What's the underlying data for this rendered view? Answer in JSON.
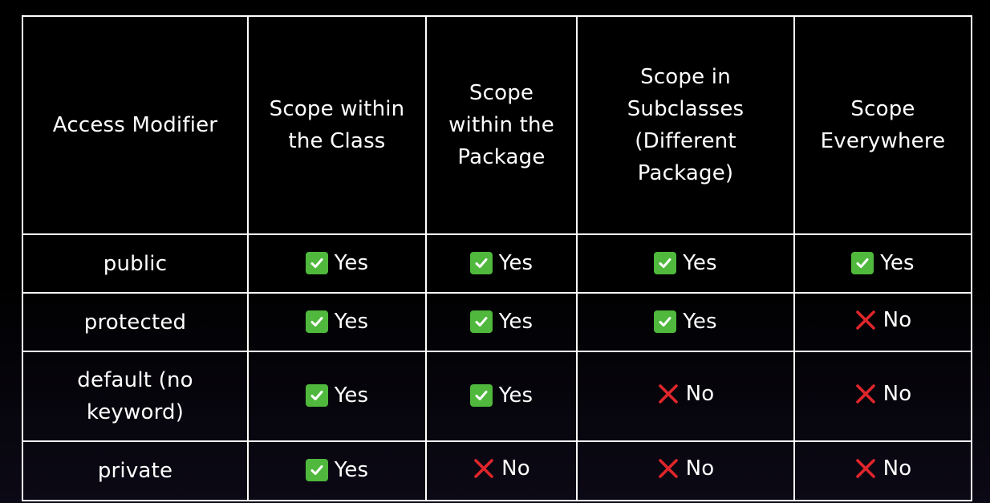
{
  "table": {
    "headers": [
      "Access Modifier",
      "Scope within the Class",
      "Scope within the Package",
      "Scope in Subclasses (Different Package)",
      "Scope Everywhere"
    ],
    "rows": [
      {
        "modifier": "public",
        "cells": [
          {
            "status": "yes",
            "text": "Yes"
          },
          {
            "status": "yes",
            "text": "Yes"
          },
          {
            "status": "yes",
            "text": "Yes"
          },
          {
            "status": "yes",
            "text": "Yes"
          }
        ]
      },
      {
        "modifier": "protected",
        "cells": [
          {
            "status": "yes",
            "text": "Yes"
          },
          {
            "status": "yes",
            "text": "Yes"
          },
          {
            "status": "yes",
            "text": "Yes"
          },
          {
            "status": "no",
            "text": "No"
          }
        ]
      },
      {
        "modifier": "default (no keyword)",
        "cells": [
          {
            "status": "yes",
            "text": "Yes"
          },
          {
            "status": "yes",
            "text": "Yes"
          },
          {
            "status": "no",
            "text": "No"
          },
          {
            "status": "no",
            "text": "No"
          }
        ]
      },
      {
        "modifier": "private",
        "cells": [
          {
            "status": "yes",
            "text": "Yes"
          },
          {
            "status": "no",
            "text": "No"
          },
          {
            "status": "no",
            "text": "No"
          },
          {
            "status": "no",
            "text": "No"
          }
        ]
      }
    ]
  },
  "colors": {
    "background": "#000000",
    "border": "#ffffff",
    "text": "#ffffff",
    "yes_icon": "#4fb83d",
    "no_icon": "#e0262b"
  },
  "icons": {
    "yes": "check-mark-button-icon",
    "no": "cross-mark-icon"
  }
}
